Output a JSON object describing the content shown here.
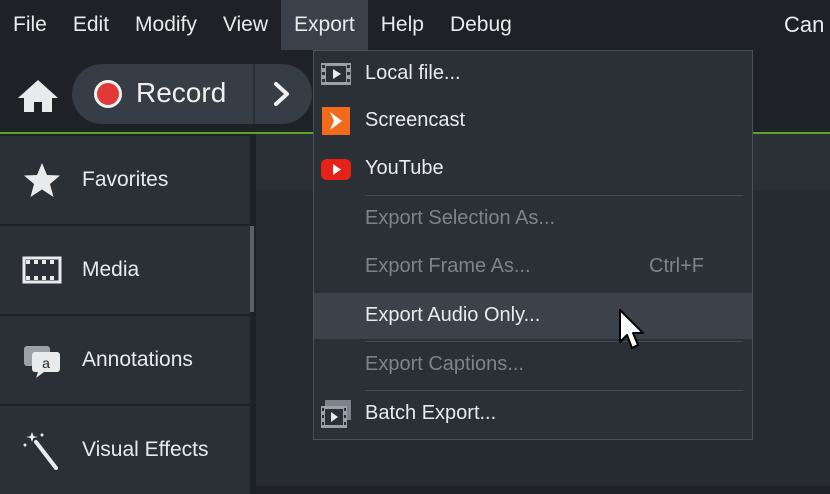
{
  "menubar": {
    "items": [
      "File",
      "Edit",
      "Modify",
      "View",
      "Export",
      "Help",
      "Debug"
    ],
    "app_title": "Can"
  },
  "toolbar": {
    "home_icon": "home-icon",
    "record_label": "Record",
    "chevron_icon": "chevron-right-icon",
    "record_color": "#e23838",
    "accent_line_color": "#5aa02c"
  },
  "sidebar": {
    "items": [
      {
        "label": "Favorites",
        "icon": "star-icon"
      },
      {
        "label": "Media",
        "icon": "film-icon"
      },
      {
        "label": "Annotations",
        "icon": "annotation-icon"
      },
      {
        "label": "Visual Effects",
        "icon": "magic-wand-icon"
      }
    ]
  },
  "export_menu": {
    "items": [
      {
        "label": "Local file...",
        "icon": "film-icon",
        "enabled": true
      },
      {
        "label": "Screencast",
        "icon": "screencast-icon",
        "enabled": true
      },
      {
        "label": "YouTube",
        "icon": "youtube-icon",
        "enabled": true
      },
      {
        "label": "Export Selection As...",
        "enabled": false
      },
      {
        "label": "Export Frame As...",
        "shortcut": "Ctrl+F",
        "enabled": false
      },
      {
        "label": "Export Audio Only...",
        "enabled": true,
        "hovered": true
      },
      {
        "label": "Export Captions...",
        "enabled": false
      },
      {
        "label": "Batch Export...",
        "icon": "batch-film-icon",
        "enabled": true
      }
    ]
  },
  "colors": {
    "screencast_orange": "#f26b1d",
    "youtube_red": "#e62117"
  }
}
